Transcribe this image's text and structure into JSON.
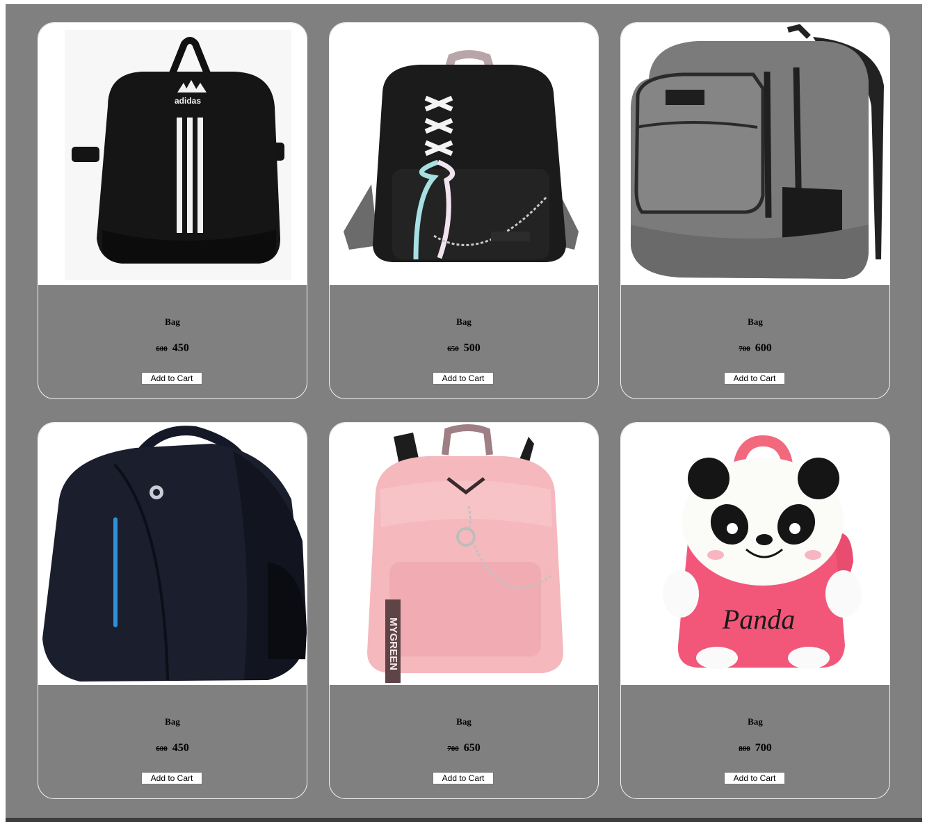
{
  "products": [
    {
      "title": "Bag",
      "old_price": "600",
      "price": "450",
      "button": "Add to Cart",
      "image": "black-sport-backpack-with-three-white-stripes",
      "logo_text": "adidas"
    },
    {
      "title": "Bag",
      "old_price": "650",
      "price": "500",
      "button": "Add to Cart",
      "image": "black-backpack-with-laces-and-chain"
    },
    {
      "title": "Bag",
      "old_price": "700",
      "price": "600",
      "button": "Add to Cart",
      "image": "grey-laptop-backpack"
    },
    {
      "title": "Bag",
      "old_price": "600",
      "price": "450",
      "button": "Add to Cart",
      "image": "navy-backpack-with-blue-zip"
    },
    {
      "title": "Bag",
      "old_price": "700",
      "price": "650",
      "button": "Add to Cart",
      "image": "pink-backpack-with-chain",
      "tag_text": "MYGREEN"
    },
    {
      "title": "Bag",
      "old_price": "800",
      "price": "700",
      "button": "Add to Cart",
      "image": "pink-panda-plush-backpack",
      "print_text": "Panda"
    }
  ],
  "colors": {
    "page_background": "#808080",
    "card_border": "#f2f2f2",
    "image_background": "#ffffff"
  }
}
